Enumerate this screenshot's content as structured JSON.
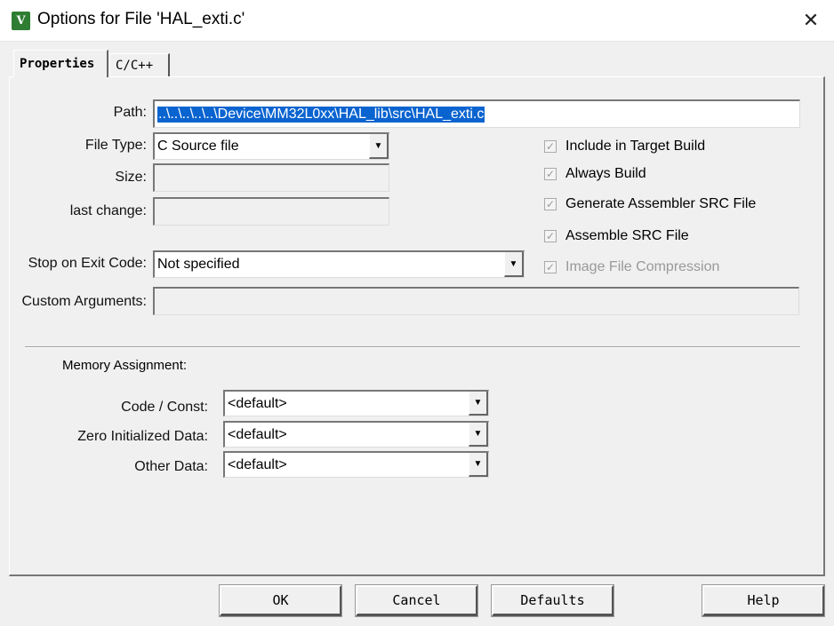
{
  "window": {
    "title": "Options for File 'HAL_exti.c'",
    "app_icon": "keil-uvision-icon",
    "close_glyph": "✕"
  },
  "tabs": [
    {
      "label": "Properties",
      "active": true
    },
    {
      "label": "C/C++",
      "active": false
    }
  ],
  "properties": {
    "path_label": "Path:",
    "path_value": "..\\..\\..\\..\\..\\Device\\MM32L0xx\\HAL_lib\\src\\HAL_exti.c",
    "file_type_label": "File Type:",
    "file_type_value": "C Source file",
    "size_label": "Size:",
    "size_value": "",
    "last_change_label": "last change:",
    "last_change_value": "",
    "stop_exit_label": "Stop on Exit Code:",
    "stop_exit_value": "Not specified",
    "custom_args_label": "Custom Arguments:",
    "custom_args_value": "",
    "checkboxes": [
      {
        "label": "Include in Target Build",
        "checked": true,
        "enabled": true
      },
      {
        "label": "Always Build",
        "checked": true,
        "enabled": true
      },
      {
        "label": "Generate Assembler SRC File",
        "checked": true,
        "enabled": true
      },
      {
        "label": "Assemble SRC File",
        "checked": true,
        "enabled": true
      },
      {
        "label": "Image File Compression",
        "checked": true,
        "enabled": false
      }
    ],
    "check_glyph": "✓",
    "dropdown_glyph": "▼"
  },
  "memory": {
    "heading": "Memory Assignment:",
    "code_const_label": "Code / Const:",
    "code_const_value": "<default>",
    "zero_init_label": "Zero Initialized Data:",
    "zero_init_value": "<default>",
    "other_data_label": "Other Data:",
    "other_data_value": "<default>"
  },
  "buttons": {
    "ok": "OK",
    "cancel": "Cancel",
    "defaults": "Defaults",
    "help": "Help"
  }
}
